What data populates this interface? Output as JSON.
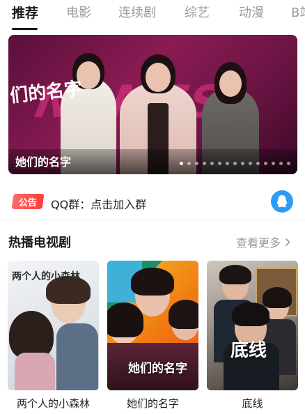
{
  "tabs": [
    "推荐",
    "电影",
    "连续剧",
    "综艺",
    "动漫",
    "B站"
  ],
  "active_tab_index": 0,
  "banner": {
    "caption": "她们的名字",
    "calligraphy": "们的名字",
    "bg_text": "NAMES",
    "dot_count": 15,
    "active_dot": 0
  },
  "notice": {
    "badge": "公告",
    "text": "QQ群：点击加入群"
  },
  "section": {
    "title": "热播电视剧",
    "more": "查看更多"
  },
  "cards": [
    {
      "title": "两个人的小森林",
      "poster_text": "两个人的小森林"
    },
    {
      "title": "她们的名字",
      "poster_text": "她们的名字"
    },
    {
      "title": "底线",
      "poster_text": "底线"
    }
  ],
  "colors": {
    "accent_active_tab": "#1a1a1a",
    "inactive_tab": "#9a9a9a",
    "notice_badge": "#ff3b3b",
    "qq_blue": "#2c9cf6"
  }
}
